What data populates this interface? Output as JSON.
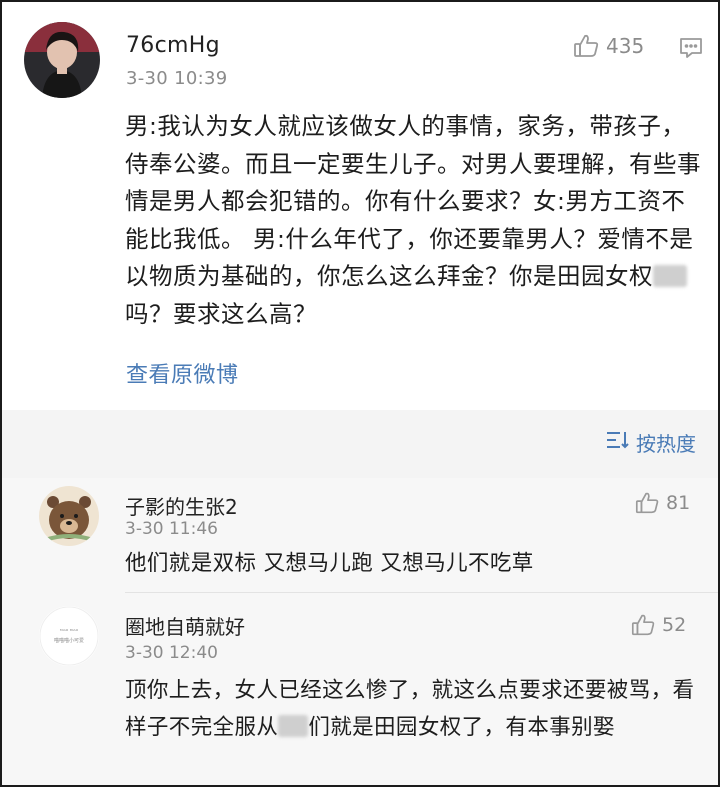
{
  "post": {
    "username": "76cmHg",
    "timestamp": "3-30 10:39",
    "like_count": "435",
    "text_part1": "男:我认为女人就应该做女人的事情，家务，带孩子，侍奉公婆。而且一定要生儿子。对男人要理解，有些事情是男人都会犯错的。你有什么要求？女:男方工资不能比我低。 男:什么年代了，你还要靠男人？爱情不是以物质为基础的，你怎么这么拜金？你是田园女权",
    "text_part2": "吗？要求这么高？",
    "view_original": "查看原微博"
  },
  "sort": {
    "label": "按热度"
  },
  "comments": [
    {
      "username": "子影的生张2",
      "timestamp": "3-30 11:46",
      "like_count": "81",
      "text": "他们就是双标 又想马儿跑 又想马儿不吃草"
    },
    {
      "username": "圈地自萌就好",
      "timestamp": "3-30 12:40",
      "like_count": "52",
      "text_part1": "顶你上去，女人已经这么惨了，就这么点要求还要被骂，看样子不完全服从",
      "text_part2": "们就是田园女权了，有本事别娶",
      "avatar_text_line1": "ᴹᴵᴬᴼ ᴹᴵᴬᴼ",
      "avatar_text_line2": "喵喵喵小可爱"
    }
  ],
  "colors": {
    "link_blue": "#4a7bb6",
    "meta_gray": "#8b8b8b",
    "band_gray": "#f4f4f4"
  },
  "icons": {
    "like": "thumbs-up-icon",
    "comment": "comment-icon",
    "sort": "sort-lines-icon"
  }
}
